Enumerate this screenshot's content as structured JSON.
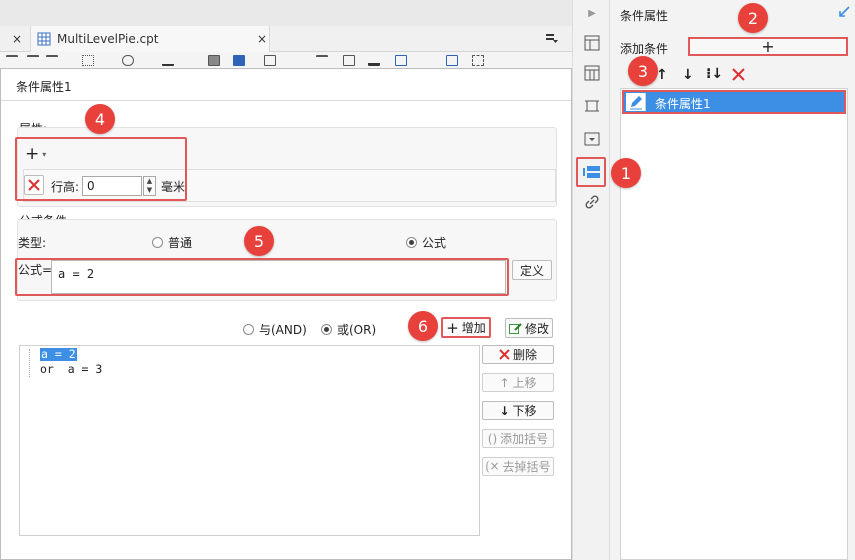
{
  "file_tab": {
    "name": "MultiLevelPie.cpt",
    "close": "×",
    "left_close": "×"
  },
  "dialog": {
    "title": "条件属性1",
    "attr_group": {
      "label": "属性:",
      "add_symbol": "+",
      "row_label": "行高:",
      "row_value": "0",
      "unit": "毫米"
    },
    "formula_group": {
      "label": "公式条件",
      "type_label": "类型:",
      "type_options": [
        {
          "label": "普通",
          "selected": false
        },
        {
          "label": "公式",
          "selected": true
        }
      ],
      "formula_label": "公式=",
      "formula_value": "a = 2",
      "define_button": "定义"
    },
    "logic_options": [
      {
        "label": "与(AND)",
        "selected": false
      },
      {
        "label": "或(OR)",
        "selected": true
      }
    ],
    "add_button": "增加",
    "modify_button": "修改",
    "conditions": [
      "a = 2",
      "or  a = 3"
    ],
    "side_buttons": [
      {
        "label": "删除",
        "enabled": true
      },
      {
        "label": "上移",
        "enabled": false
      },
      {
        "label": "下移",
        "enabled": true
      },
      {
        "label": "添加括号",
        "enabled": false
      },
      {
        "label": "去掉括号",
        "enabled": false
      }
    ]
  },
  "right_panel": {
    "title": "条件属性",
    "add_condition_label": "添加条件",
    "add_symbol": "+",
    "list_items": [
      {
        "label": "条件属性1",
        "selected": true
      }
    ]
  },
  "badges": [
    "1",
    "2",
    "3",
    "4",
    "5",
    "6"
  ],
  "colors": {
    "accent_blue": "#3d8fe6",
    "badge_red": "#e8413b",
    "highlight_red": "#e25757",
    "delete_red": "#e02f2f"
  }
}
